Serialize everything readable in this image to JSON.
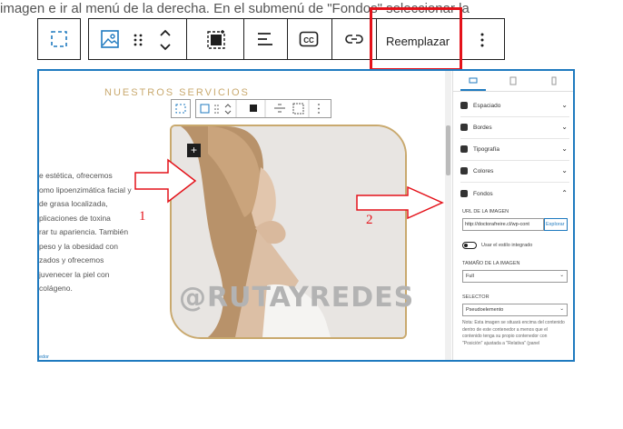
{
  "intro_text": "imagen e ir al menú de la derecha. En el submenú de \"Fondos\" seleccionar la",
  "intro_overlap": "n",
  "toolbar": {
    "replace_label": "Reemplazar",
    "icons": [
      "select-parent-icon",
      "image-icon",
      "drag-handle-icon",
      "move-up-down-icon",
      "crop-icon",
      "align-icon",
      "caption-icon",
      "link-icon",
      "more-options-icon"
    ]
  },
  "editor": {
    "section_title": "NUESTROS SERVICIOS",
    "left_text": [
      "e estética, ofrecemos",
      "omo lipoenzimática facial y",
      "de grasa localizada,",
      "plicaciones de toxina",
      "rar tu apariencia. También",
      "peso y la obesidad con",
      "zados y ofrecemos",
      "juvenecer la piel con",
      " colágeno."
    ],
    "watermark": "@RUTAYREDES",
    "add_block_symbol": "+",
    "footer_fragment": "edor"
  },
  "panel": {
    "rows": [
      "Espaciado",
      "Bordes",
      "Tipografía",
      "Colores",
      "Fondos"
    ],
    "url_label": "URL DE LA IMAGEN",
    "url_value": "http://doctorafreire.cl/wp-cont",
    "explore_label": "Explorar",
    "toggle_label": "Usar el estilo integrado",
    "size_label": "TAMAÑO DE LA IMAGEN",
    "size_value": "Full",
    "selector_label": "SELECTOR",
    "selector_value": "Pseudoelemento",
    "note": "Nota: Esta imagen se situará encima del contenido dentro de este contenedor a menos que el contenido tenga su propio contenedor con \"Posición\" ajustada a \"Relativa\" (panel"
  },
  "annotations": {
    "arrow1_label": "1",
    "arrow2_label": "2",
    "highlight_color": "#e4121a"
  }
}
